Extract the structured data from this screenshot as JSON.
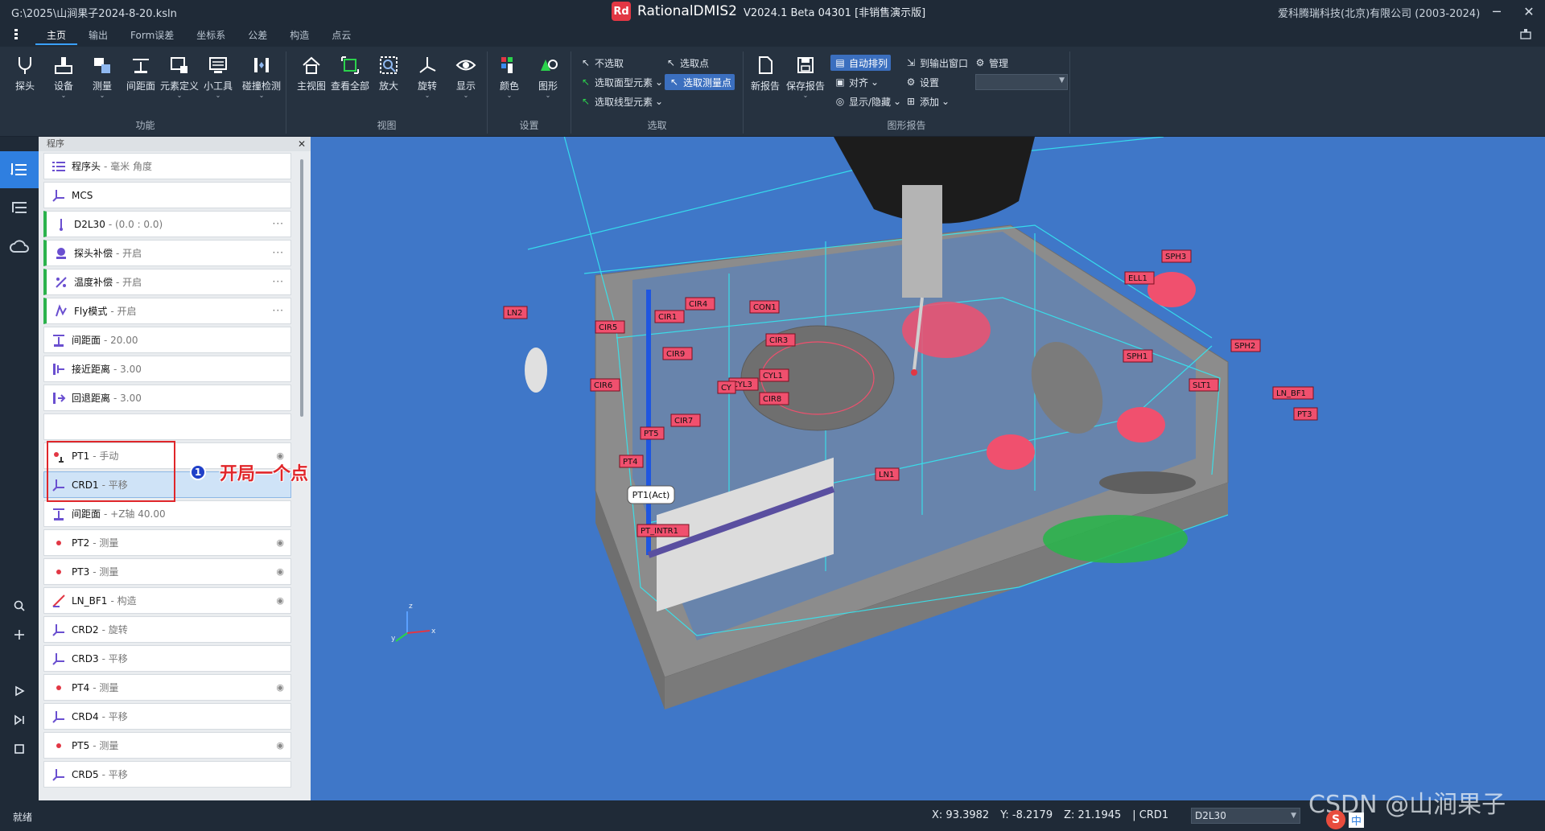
{
  "titlebar": {
    "file_path": "G:\\2025\\山涧果子2024-8-20.ksln",
    "app_logo": "Rd",
    "app_name": "RationalDMIS2",
    "version": "V2024.1 Beta 04301 [非销售演示版]",
    "company": "爱科腾瑞科技(北京)有限公司 (2003-2024)",
    "minimize": "─",
    "close": "✕"
  },
  "menu": {
    "tabs": [
      "主页",
      "输出",
      "Form误差",
      "坐标系",
      "公差",
      "构造",
      "点云"
    ],
    "active_tab": "主页"
  },
  "ribbon": {
    "groups": {
      "function": {
        "label": "功能",
        "buttons": [
          "探头",
          "设备",
          "测量",
          "间距面",
          "元素定义",
          "小工具",
          "碰撞检测"
        ]
      },
      "view": {
        "label": "视图",
        "buttons": [
          "主视图",
          "查看全部",
          "放大",
          "旋转",
          "显示"
        ]
      },
      "settings": {
        "label": "设置",
        "buttons": [
          "颜色",
          "图形"
        ]
      },
      "select": {
        "label": "选取",
        "items": [
          "不选取",
          "选取面型元素",
          "选取线型元素",
          "选取点",
          "选取测量点"
        ]
      },
      "graphic_report": {
        "label": "图形报告",
        "buttons": [
          "新报告",
          "保存报告"
        ],
        "items": [
          "自动排列",
          "对齐",
          "显示/隐藏",
          "到输出窗口",
          "设置",
          "添加",
          "管理"
        ]
      }
    }
  },
  "program": {
    "header": "程序",
    "close": "✕",
    "items": [
      {
        "name": "程序头",
        "desc": "- 毫米 角度",
        "icon": "list-icon",
        "green": false
      },
      {
        "name": "MCS",
        "desc": "",
        "icon": "axis-icon",
        "green": false
      },
      {
        "name": "D2L30",
        "desc": "- (0.0 : 0.0)",
        "icon": "probe-icon",
        "green": true,
        "more": "···"
      },
      {
        "name": "探头补偿",
        "desc": "- 开启",
        "icon": "probe-comp-icon",
        "green": true,
        "more": "···"
      },
      {
        "name": "温度补偿",
        "desc": "- 开启",
        "icon": "temp-icon",
        "green": true,
        "more": "···"
      },
      {
        "name": "Fly模式",
        "desc": "- 开启",
        "icon": "fly-icon",
        "green": true,
        "more": "···"
      },
      {
        "name": "间距面",
        "desc": "- 20.00",
        "icon": "clearance-icon",
        "green": false
      },
      {
        "name": "接近距离",
        "desc": "- 3.00",
        "icon": "approach-icon",
        "green": false
      },
      {
        "name": "回退距离",
        "desc": "- 3.00",
        "icon": "retract-icon",
        "green": false
      },
      {
        "name": "",
        "desc": "",
        "icon": "",
        "green": false,
        "blank": true
      },
      {
        "name": "PT1",
        "desc": "- 手动",
        "icon": "point-manual-icon",
        "green": false,
        "eye": "◉"
      },
      {
        "name": "CRD1",
        "desc": "- 平移",
        "icon": "axis-icon",
        "green": false,
        "selected": true
      },
      {
        "name": "间距面",
        "desc": "- +Z轴 40.00",
        "icon": "clearance-icon",
        "green": false
      },
      {
        "name": "PT2",
        "desc": "- 测量",
        "icon": "point-icon",
        "green": false,
        "eye": "◉"
      },
      {
        "name": "PT3",
        "desc": "- 测量",
        "icon": "point-icon",
        "green": false,
        "eye": "◉"
      },
      {
        "name": "LN_BF1",
        "desc": "- 构造",
        "icon": "line-icon",
        "green": false,
        "eye": "◉"
      },
      {
        "name": "CRD2",
        "desc": "- 旋转",
        "icon": "axis-icon",
        "green": false
      },
      {
        "name": "CRD3",
        "desc": "- 平移",
        "icon": "axis-icon",
        "green": false
      },
      {
        "name": "PT4",
        "desc": "- 测量",
        "icon": "point-icon",
        "green": false,
        "eye": "◉"
      },
      {
        "name": "CRD4",
        "desc": "- 平移",
        "icon": "axis-icon",
        "green": false
      },
      {
        "name": "PT5",
        "desc": "- 测量",
        "icon": "point-icon",
        "green": false,
        "eye": "◉"
      },
      {
        "name": "CRD5",
        "desc": "- 平移",
        "icon": "axis-icon",
        "green": false
      }
    ]
  },
  "annotation": {
    "number": "1",
    "text": "开局一个点"
  },
  "viewport": {
    "labels": [
      "SPH3",
      "ELL1",
      "LN2",
      "CIR4",
      "CON1",
      "CIR1",
      "CIR5",
      "CIR3",
      "CIR9",
      "SPH2",
      "SPH1",
      "CYL1",
      "CYL3",
      "CY",
      "SLT1",
      "CIR6",
      "CIR8",
      "LN_BF1",
      "PT3",
      "CIR7",
      "PT5",
      "PT4",
      "LN1",
      "PT_INTR1"
    ],
    "tooltip": "PT1(Act)",
    "axis_labels": {
      "z": "z",
      "y": "y",
      "x": "x"
    },
    "colors": {
      "background": "#3f77c8",
      "label_fill": "#f0506e",
      "wireframe": "#35e6f0",
      "part": "#8c8c8c"
    }
  },
  "status": {
    "left": "就绪",
    "x": "X: 93.3982",
    "y": "Y: -8.2179",
    "z": "Z: 21.1945",
    "crd": "| CRD1",
    "probe": "D2L30"
  },
  "watermark": "CSDN @山涧果子",
  "ime": {
    "logo": "S",
    "lang": "中"
  }
}
